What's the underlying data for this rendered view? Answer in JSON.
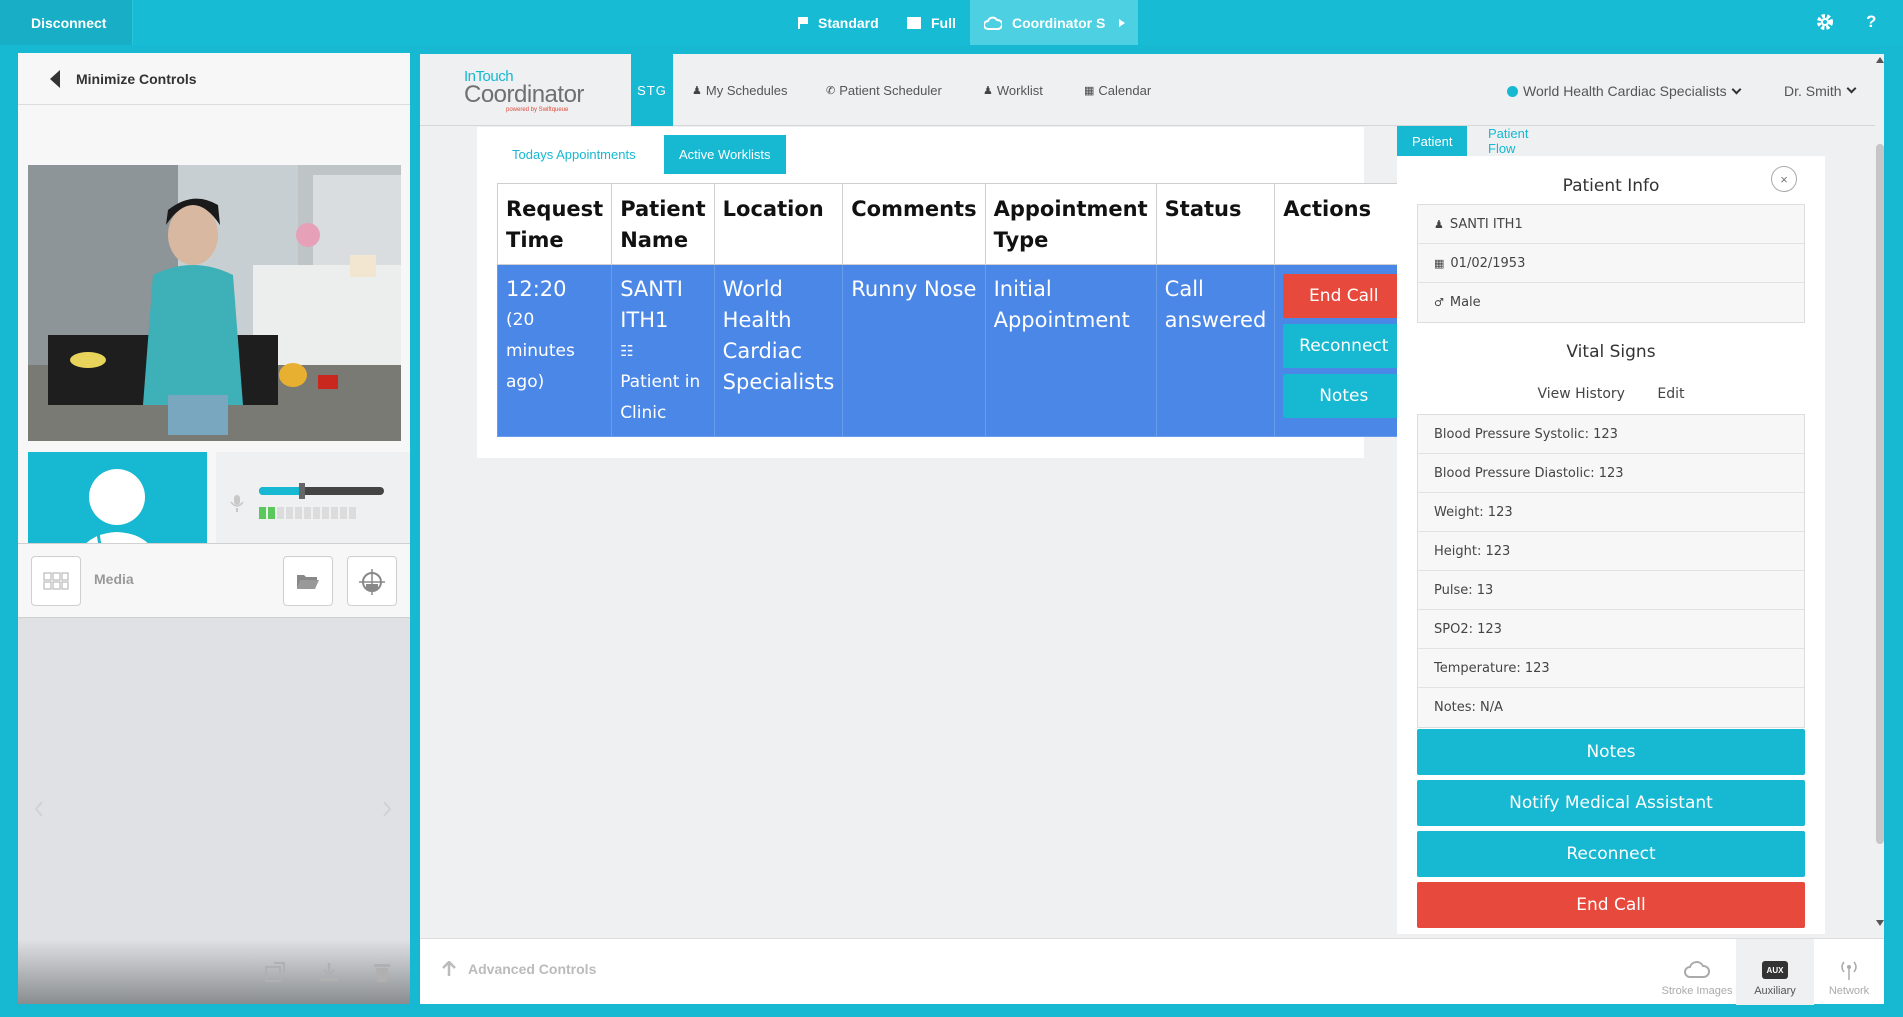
{
  "topbar": {
    "disconnect": "Disconnect",
    "modes": {
      "standard": "Standard",
      "full": "Full",
      "coordinator": "Coordinator S"
    },
    "help": "?"
  },
  "left": {
    "minimize_label": "Minimize Controls",
    "media_label": "Media",
    "volume_level": 0.34
  },
  "nav": {
    "logo_top": "InTouch",
    "logo_main": "Coordinator",
    "logo_sub": "powered by Swiftqueue",
    "stg": "STG",
    "links": [
      "My Schedules",
      "Patient Scheduler",
      "Worklist",
      "Calendar"
    ],
    "org": "World Health Cardiac Specialists",
    "user": "Dr. Smith"
  },
  "worklist": {
    "tabs": [
      "Todays Appointments",
      "Active Worklists"
    ],
    "headers": [
      "Request Time",
      "Patient Name",
      "Location",
      "Comments",
      "Appointment Type",
      "Status",
      "Actions"
    ],
    "row": {
      "time": "12:20",
      "time_ago": "(20 minutes ago)",
      "patient": "SANTI ITH1",
      "patient_status": "Patient in Clinic",
      "location": "World Health Cardiac Specialists",
      "comments": "Runny Nose",
      "appt_type": "Initial Appointment",
      "status": "Call answered",
      "actions": [
        "End Call",
        "Reconnect",
        "Notes"
      ]
    }
  },
  "patient_panel": {
    "tabs": [
      "Patient",
      "Patient Flow"
    ],
    "close": "×",
    "info_title": "Patient Info",
    "name": "SANTI ITH1",
    "dob": "01/02/1953",
    "gender": "Male",
    "vitals_title": "Vital Signs",
    "view_history": "View History",
    "edit": "Edit",
    "vitals": [
      "Blood Pressure Systolic: 123",
      "Blood Pressure Diastolic: 123",
      "Weight: 123",
      "Height: 123",
      "Pulse: 13",
      "SPO2: 123",
      "Temperature: 123",
      "Notes: N/A"
    ],
    "buttons": [
      "Notes",
      "Notify Medical Assistant",
      "Reconnect",
      "End Call"
    ]
  },
  "bottombar": {
    "advanced": "Advanced Controls",
    "stroke": "Stroke Images",
    "aux_icon": "AUX",
    "auxiliary": "Auxiliary",
    "network": "Network"
  },
  "colors": {
    "teal": "#17b8d1",
    "row_blue": "#4b87e6",
    "red": "#e74a3c"
  }
}
